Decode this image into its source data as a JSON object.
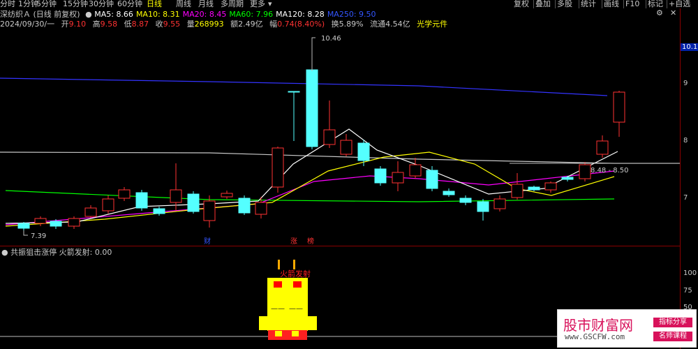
{
  "toolbar": {
    "left_items": [
      "分时",
      "1分钟",
      "5分钟",
      "15分钟",
      "30分钟",
      "60分钟",
      "日线",
      "周线",
      "月线",
      "多周期",
      "更多"
    ],
    "active": "日线",
    "more_arrow": "▾",
    "right_items": [
      "复权",
      "叠加",
      "多股",
      "统计",
      "画线",
      "F10",
      "标记",
      "+自选"
    ],
    "right_icon": "settings-icon"
  },
  "info": {
    "stock_name": "深纺织Ａ",
    "adjust_mode": "(日线 前复权)",
    "ma": [
      {
        "label": "MA5:",
        "value": "8.66",
        "color": "#ffffff"
      },
      {
        "label": "MA10:",
        "value": "8.31",
        "color": "#ffff00"
      },
      {
        "label": "MA20:",
        "value": "8.45",
        "color": "#ff00ff"
      },
      {
        "label": "MA60:",
        "value": "7.96",
        "color": "#00ff00"
      },
      {
        "label": "MA120:",
        "value": "8.28",
        "color": "#ffffff"
      },
      {
        "label": "MA250:",
        "value": "9.50",
        "color": "#3355ff"
      }
    ],
    "date": "2024/09/30/一",
    "open_label": "开",
    "open": "9.10",
    "high_label": "高",
    "high": "9.58",
    "low_label": "低",
    "low": "8.87",
    "close_label": "收",
    "close": "9.55",
    "vol_label": "量",
    "vol": "268993",
    "amt_label": "额",
    "amt": "2.49亿",
    "chg_label": "幅",
    "chg": "0.74(8.40%)",
    "turn_label": "换",
    "turn": "5.89%",
    "float_label": "流通",
    "float": "4.54亿",
    "sector": "光学元件"
  },
  "y_axis": {
    "highlight": "10.17",
    "ticks": [
      "9",
      "8",
      "7"
    ]
  },
  "annotations": {
    "high_price": "10.46",
    "low_price": "7.39",
    "range_label": "8.48 - 8.50",
    "event_1": "财",
    "event_2": "涨",
    "event_3": "榜"
  },
  "indicator": {
    "name": "共振狙击涨停",
    "signal_label": "火箭发射:",
    "signal_value": "0.00",
    "rocket_text": "火箭发射",
    "dash_text": "——",
    "axis_ticks": [
      "100",
      "75",
      "50"
    ]
  },
  "watermark": {
    "title": "股市财富网",
    "url": "www.GSCFW.com",
    "tag1": "指标分享",
    "tag2": "名师课程"
  },
  "colors": {
    "up": "#ff3232",
    "down": "#54ffff",
    "ma5": "#ffffff",
    "ma10": "#ffff00",
    "ma20": "#ff00ff",
    "ma60": "#00ff00",
    "ma120": "#c8c8c8",
    "ma250": "#3333ff",
    "border": "#8a0000"
  }
}
